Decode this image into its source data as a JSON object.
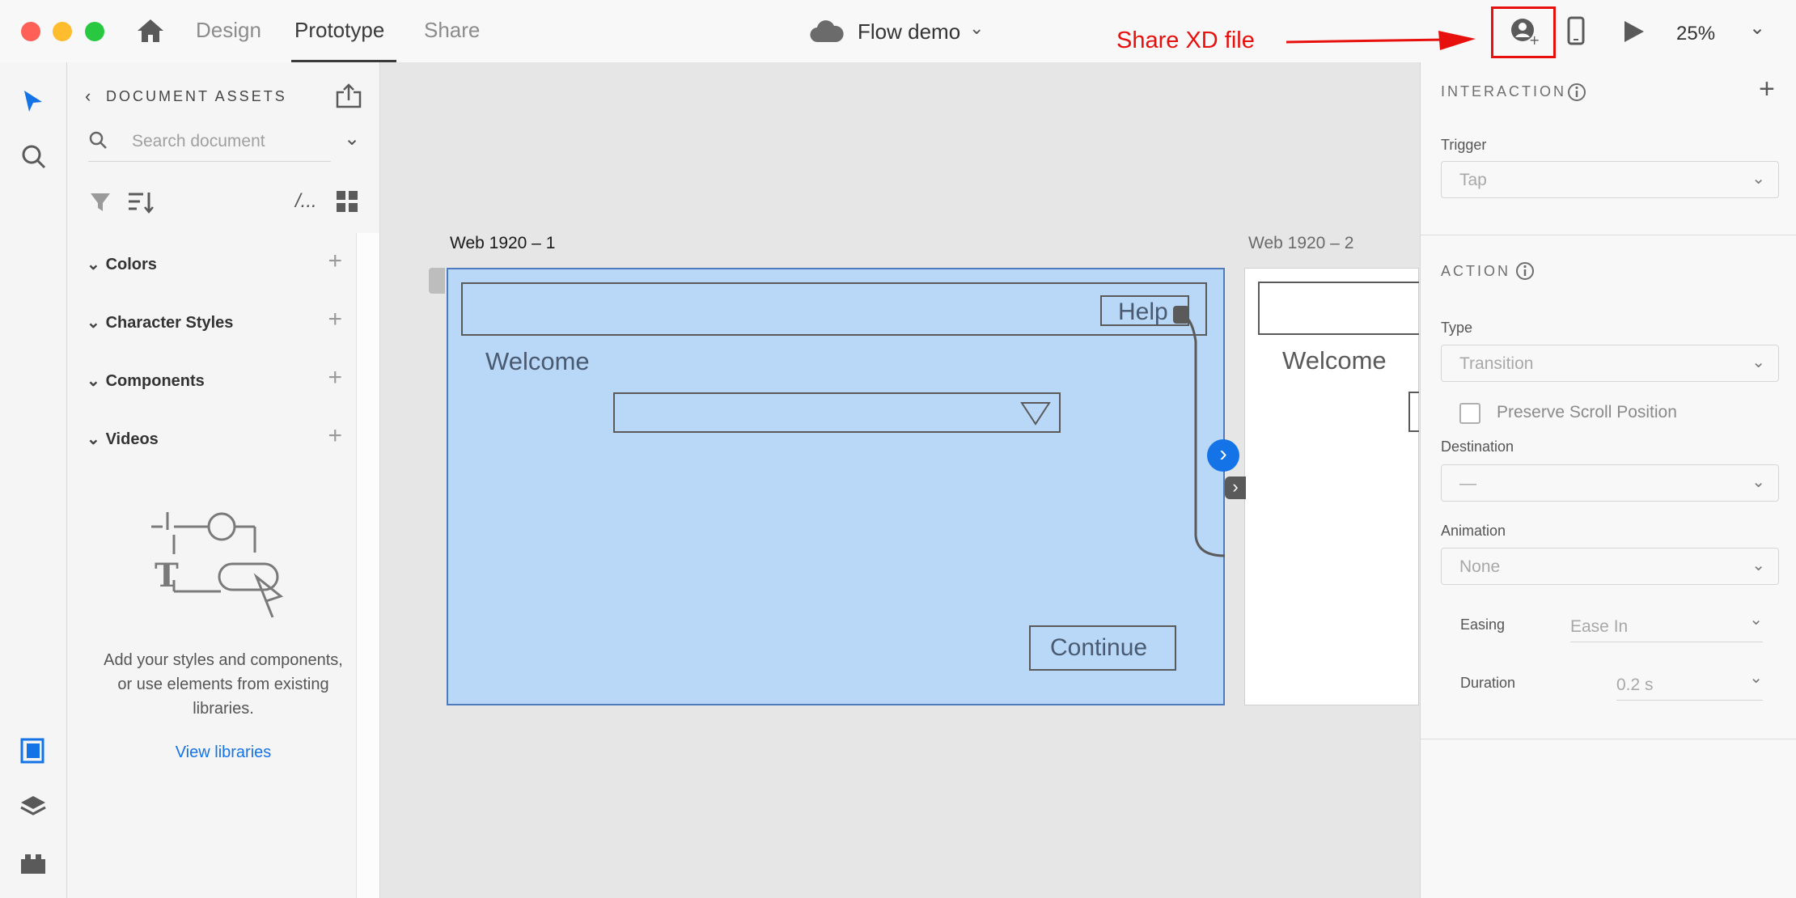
{
  "app": {
    "tabs": [
      "Design",
      "Prototype",
      "Share"
    ],
    "active_tab": "Prototype",
    "document_title": "Flow demo",
    "zoom": "25%"
  },
  "annotation": {
    "label": "Share XD file",
    "color": "#e8100c"
  },
  "assets": {
    "title": "DOCUMENT ASSETS",
    "search_placeholder": "Search document",
    "view_toggle_label": "/...",
    "sections": [
      "Colors",
      "Character Styles",
      "Components",
      "Videos"
    ],
    "empty_message_lines": [
      "Add your styles and components,",
      "or use elements from existing",
      "libraries."
    ],
    "view_libraries_link": "View libraries",
    "link_color": "#1473e6"
  },
  "canvas": {
    "artboard1": {
      "name": "Web 1920 – 1",
      "help_label": "Help",
      "welcome_label": "Welcome",
      "continue_label": "Continue",
      "fill_color": "#b9d7f7",
      "border_color": "#4d7bbd"
    },
    "artboard2": {
      "name": "Web 1920 – 2",
      "welcome_label": "Welcome"
    },
    "connector_color": "#1473e6"
  },
  "interaction": {
    "title": "INTERACTION",
    "trigger_label": "Trigger",
    "trigger_value": "Tap"
  },
  "action": {
    "title": "ACTION",
    "type_label": "Type",
    "type_value": "Transition",
    "preserve_scroll_label": "Preserve Scroll Position",
    "destination_label": "Destination",
    "destination_value": "—",
    "animation_label": "Animation",
    "animation_value": "None",
    "easing_label": "Easing",
    "easing_value": "Ease In",
    "duration_label": "Duration",
    "duration_value": "0.2 s"
  }
}
